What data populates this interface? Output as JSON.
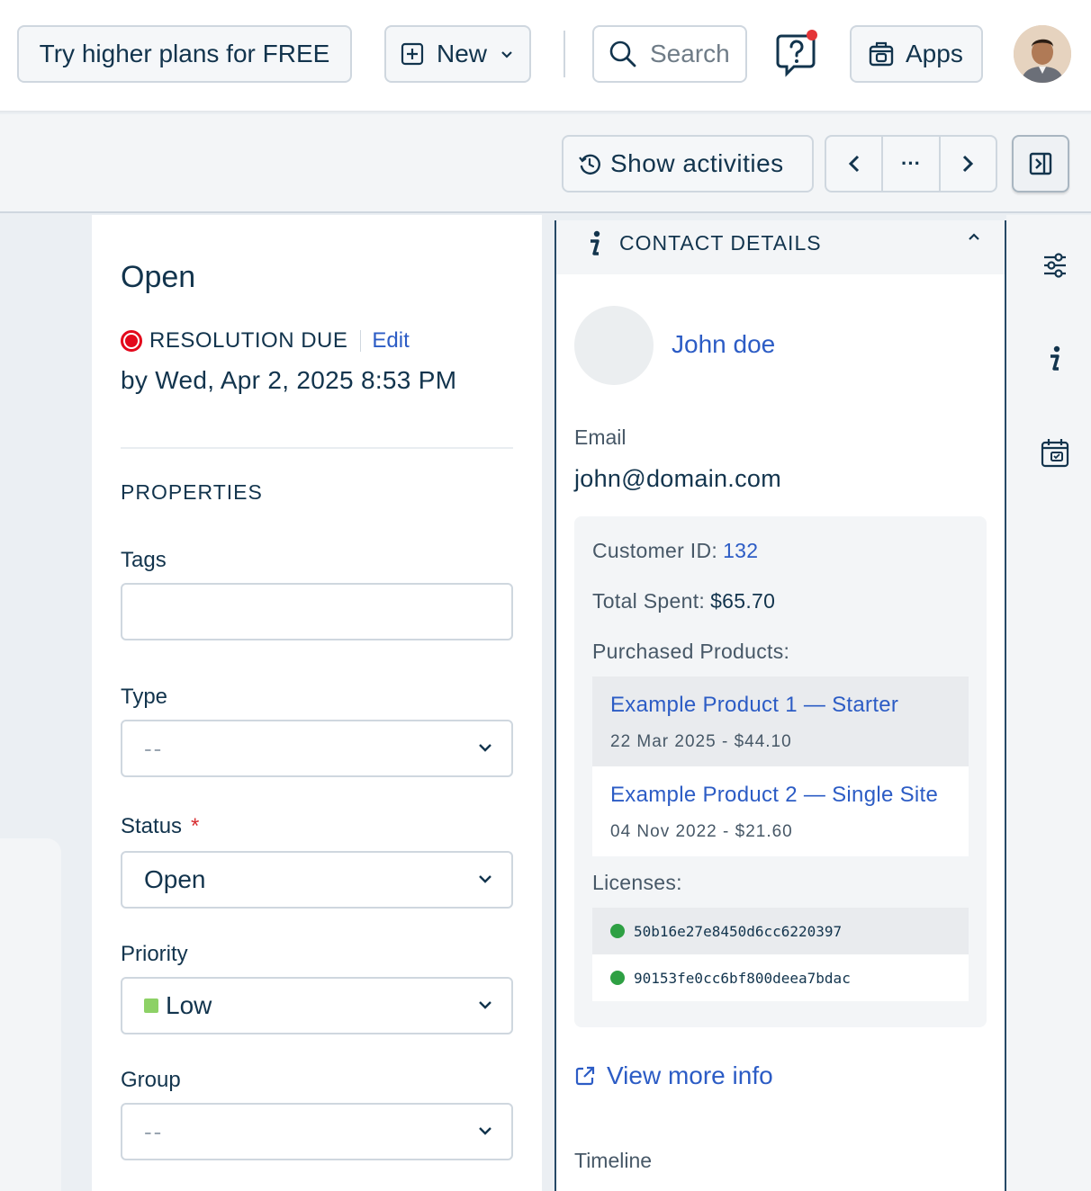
{
  "topbar": {
    "upgrade_label": "Try higher plans for FREE",
    "new_label": "New",
    "search_placeholder": "Search",
    "apps_label": "Apps"
  },
  "subbar": {
    "show_activities_label": "Show activities",
    "more_label": "···"
  },
  "ticket": {
    "status_title": "Open",
    "resolution_label": "RESOLUTION DUE",
    "edit_label": "Edit",
    "due_text": "by Wed, Apr 2, 2025 8:53 PM",
    "properties_heading": "PROPERTIES",
    "fields": {
      "tags_label": "Tags",
      "tags_value": "",
      "type_label": "Type",
      "type_value": "--",
      "status_label": "Status",
      "status_required": "*",
      "status_value": "Open",
      "priority_label": "Priority",
      "priority_value": "Low",
      "priority_color": "#8dd166",
      "group_label": "Group",
      "group_value": "--"
    }
  },
  "contact": {
    "heading": "CONTACT DETAILS",
    "name": "John doe",
    "email_label": "Email",
    "email": "john@domain.com",
    "customer_id_label": "Customer ID:",
    "customer_id": "132",
    "total_spent_label": "Total Spent:",
    "total_spent": "$65.70",
    "purchased_label": "Purchased Products:",
    "products": [
      {
        "name": "Example Product 1 — Starter",
        "meta": "22 Mar 2025 - $44.10"
      },
      {
        "name": "Example Product 2 — Single Site",
        "meta": "04 Nov 2022 - $21.60"
      }
    ],
    "licenses_label": "Licenses:",
    "licenses": [
      {
        "key": "50b16e27e8450d6cc6220397",
        "status_color": "#2ea043"
      },
      {
        "key": "90153fe0cc6bf800deea7bdac",
        "status_color": "#2ea043"
      }
    ],
    "view_more_label": "View more info",
    "timeline_label": "Timeline"
  },
  "colors": {
    "link": "#2c5cc5",
    "text": "#12344d",
    "danger": "#e3081c",
    "notification_dot": "#e43538"
  }
}
